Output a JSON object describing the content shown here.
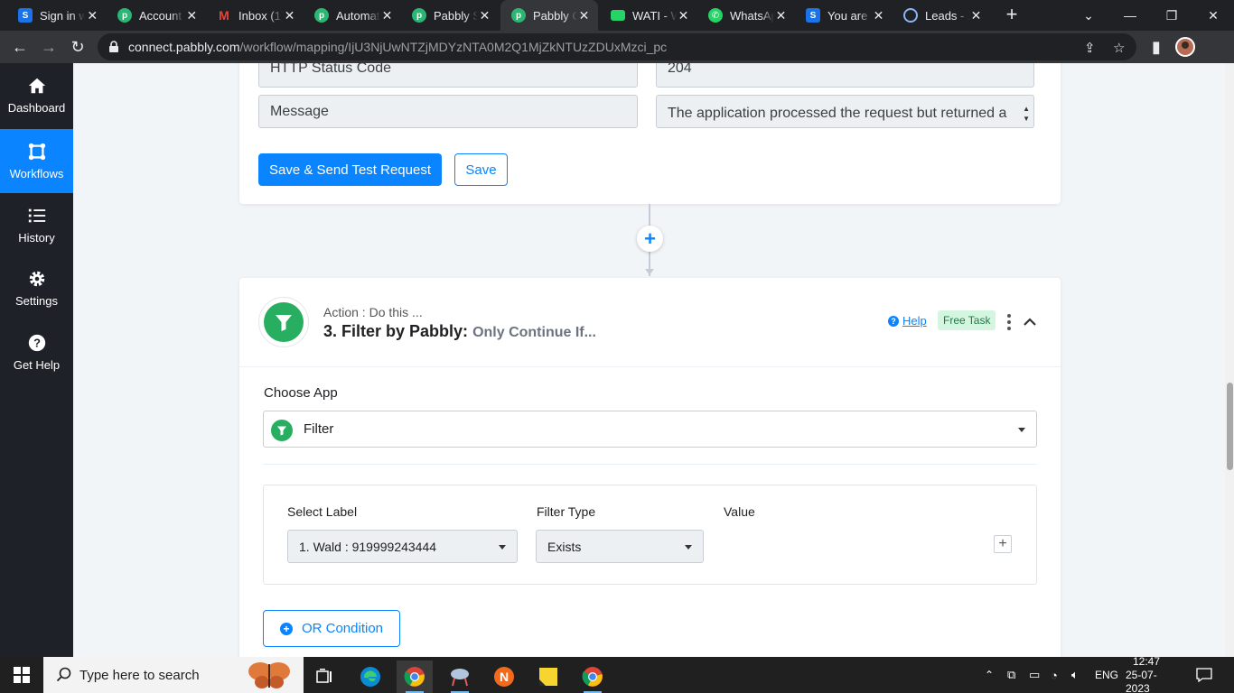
{
  "browser": {
    "tabs": [
      {
        "title": "Sign in with Scalefusion",
        "favicon": "S",
        "color": "#1a73e8"
      },
      {
        "title": "Account",
        "favicon": "p",
        "color": "#2bb673"
      },
      {
        "title": "Inbox (1)",
        "favicon": "M",
        "color": "#ea4335"
      },
      {
        "title": "Automation",
        "favicon": "p",
        "color": "#2bb673"
      },
      {
        "title": "Pabbly Subscription",
        "favicon": "p",
        "color": "#2bb673"
      },
      {
        "title": "Pabbly Connect",
        "favicon": "p",
        "color": "#2bb673"
      },
      {
        "title": "WATI - WhatsApp",
        "favicon": "W",
        "color": "#25d366"
      },
      {
        "title": "WhatsApp",
        "favicon": "W",
        "color": "#25d366"
      },
      {
        "title": "You are",
        "favicon": "S",
        "color": "#1a73e8"
      },
      {
        "title": "Leads - Zoho",
        "favicon": "Z",
        "color": "#8ab4f8"
      }
    ],
    "active_tab": 5,
    "url_domain": "connect.pabbly.com",
    "url_path": "/workflow/mapping/IjU3NjUwNTZjMDYzNTA0M2Q1MjZkNTUzZDUxMzci_pc"
  },
  "sidebar": {
    "items": [
      {
        "label": "Dashboard",
        "icon": "home-icon"
      },
      {
        "label": "Workflows",
        "icon": "workflow-icon"
      },
      {
        "label": "History",
        "icon": "history-icon"
      },
      {
        "label": "Settings",
        "icon": "gear-icon"
      },
      {
        "label": "Get Help",
        "icon": "help-icon"
      }
    ],
    "active": 1
  },
  "response_step": {
    "status_label": "HTTP Status Code",
    "status_value": "204",
    "message_label": "Message",
    "message_value": "The application processed the request but returned a blank response. Refer to the HTTP",
    "save_send_label": "Save & Send Test Request",
    "save_label": "Save"
  },
  "filter_step": {
    "action_caption": "Action : Do this ...",
    "step_title": "3. Filter by Pabbly:",
    "step_subtitle": "Only Continue If...",
    "help_label": "Help",
    "badge": "Free Task",
    "choose_app_label": "Choose App",
    "app_value": "Filter",
    "select_label_header": "Select Label",
    "filter_type_header": "Filter Type",
    "value_header": "Value",
    "select_label_value": "1. Wald : 919999243444",
    "filter_type_value": "Exists",
    "or_condition_label": "OR Condition"
  },
  "taskbar": {
    "search_placeholder": "Type here to search",
    "lang": "ENG",
    "time": "12:47",
    "date": "25-07-2023"
  },
  "colors": {
    "accent": "#0a84ff",
    "filter_green": "#27ae60",
    "badge_bg": "#d4f5e0",
    "badge_text": "#1e7b45"
  }
}
